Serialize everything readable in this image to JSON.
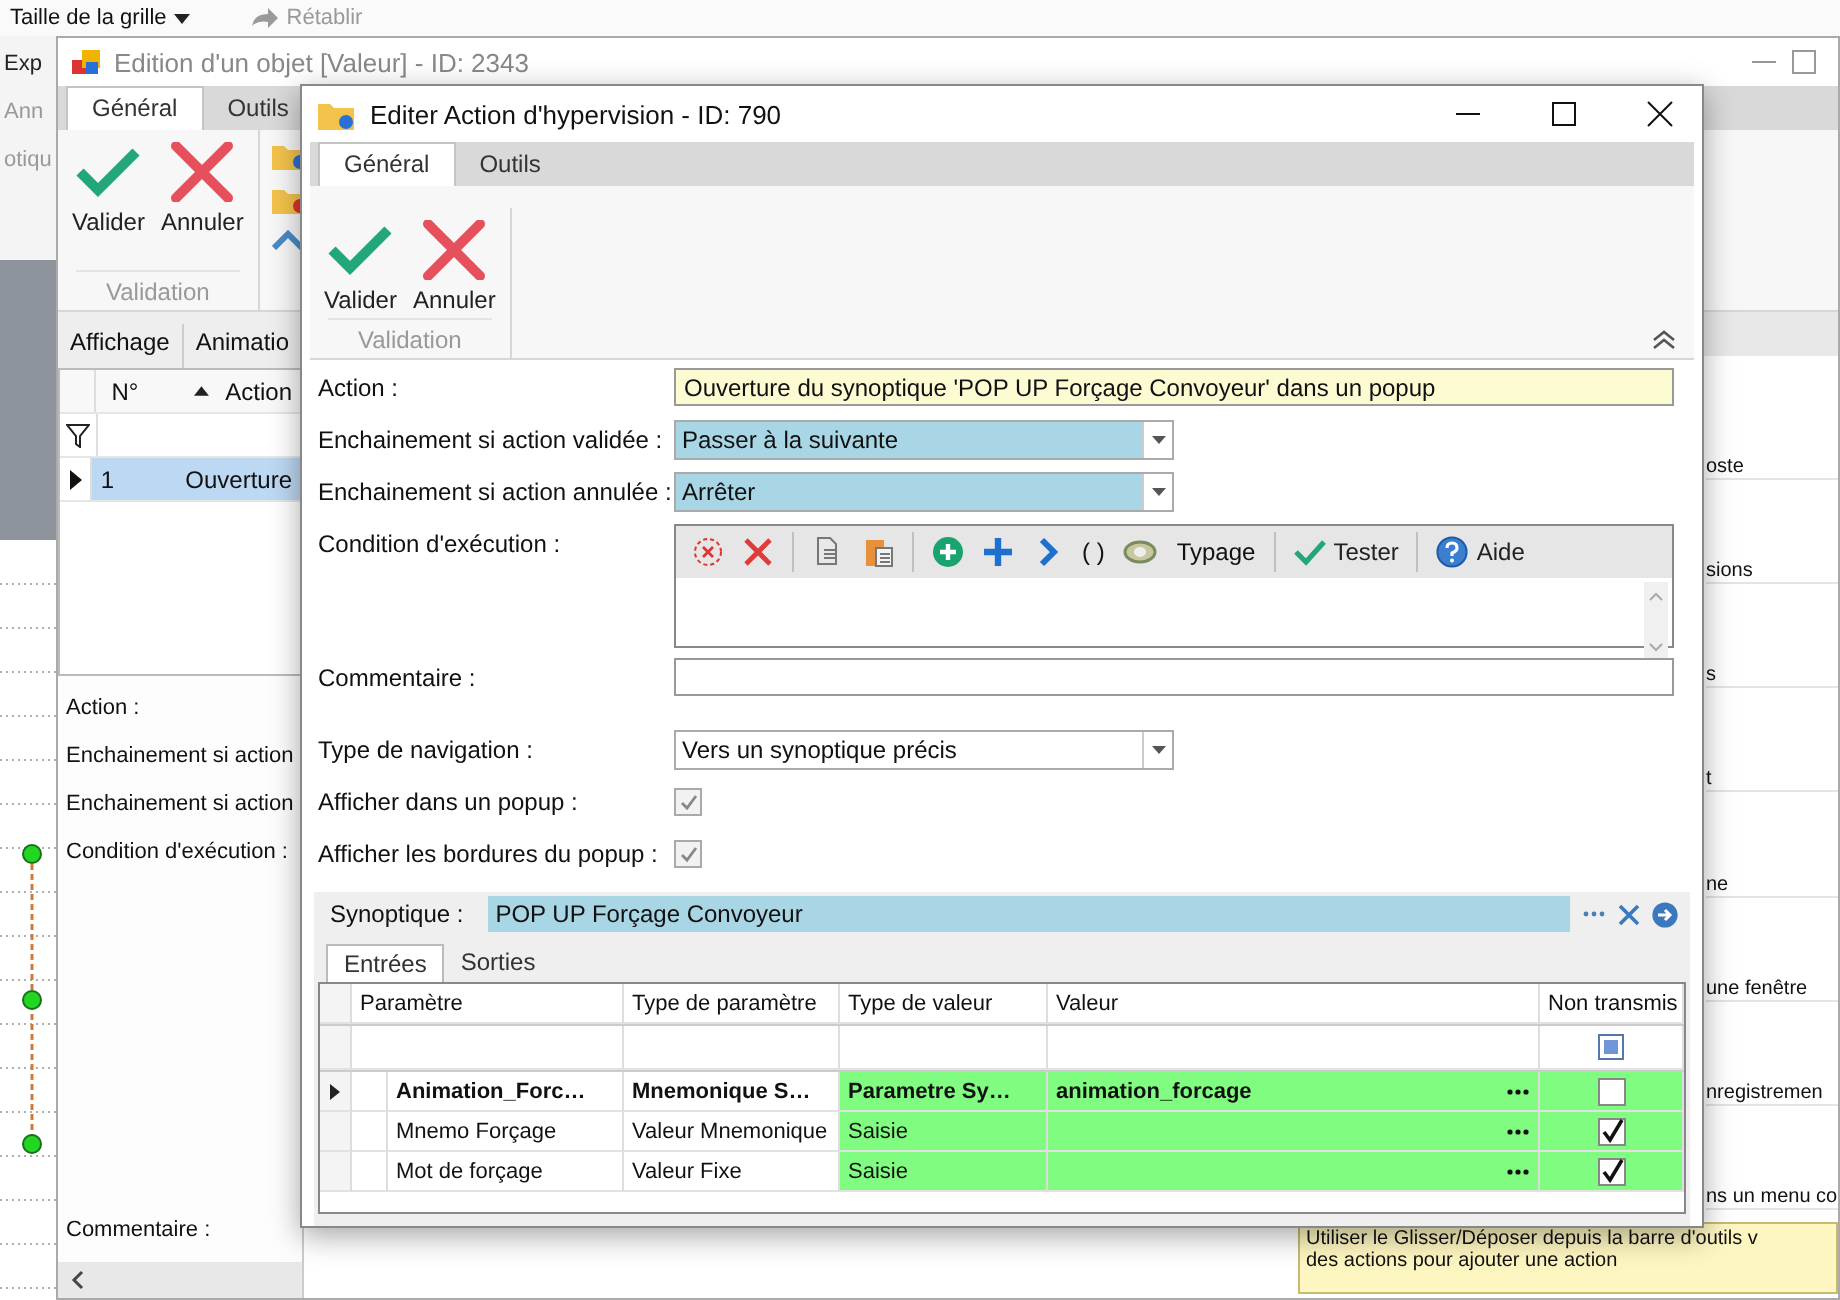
{
  "background_app": {
    "toolbar": [
      {
        "kind": "dropdown",
        "label": "Taille de la grille",
        "disabled": false
      },
      {
        "kind": "redo",
        "label": "Rétablir",
        "disabled": true
      }
    ],
    "partial_labels": [
      "Exp",
      "Ann",
      "otiqu"
    ]
  },
  "back_window": {
    "title": "Edition d'un objet [Valeur] - ID: 2343",
    "tabs": [
      {
        "label": "Général",
        "selected": true
      },
      {
        "label": "Outils",
        "selected": false
      }
    ],
    "ribbon_buttons": [
      {
        "kind": "validate",
        "label": "Valider"
      },
      {
        "kind": "cancel",
        "label": "Annuler"
      }
    ],
    "ribbon_group": "Validation",
    "grid_tabs": [
      "Affichage",
      "Animatio"
    ],
    "grid_columns": [
      "N°",
      "Action"
    ],
    "grid_rows": [
      {
        "number": "1",
        "action": "Ouverture",
        "selected": true
      }
    ],
    "form_labels": [
      "Action :",
      "Enchainement si action",
      "Enchainement si action",
      "Condition d'exécution :",
      "Commentaire :"
    ],
    "side_list": [
      "oste",
      "sions",
      "s",
      "t",
      "ne",
      "une fenêtre",
      "nregistremen",
      "ns un menu co"
    ],
    "hint": [
      "Utiliser le Glisser/Déposer depuis la barre d'outils v",
      "des actions pour ajouter une action"
    ]
  },
  "dialog": {
    "title": "Editer Action d'hypervision - ID: 790",
    "tabs": [
      {
        "label": "Général",
        "selected": true
      },
      {
        "label": "Outils",
        "selected": false
      }
    ],
    "ribbon_buttons": [
      {
        "kind": "validate",
        "label": "Valider"
      },
      {
        "kind": "cancel",
        "label": "Annuler"
      }
    ],
    "ribbon_group": "Validation",
    "fields": [
      {
        "kind": "text",
        "label": "Action :",
        "value": "Ouverture du synoptique 'POP UP Forçage Convoyeur' dans un popup",
        "readonly": true
      },
      {
        "kind": "combo",
        "label": "Enchainement si action validée :",
        "value": "Passer à la suivante",
        "highlighted": true
      },
      {
        "kind": "combo",
        "label": "Enchainement si action annulée :",
        "value": "Arrêter",
        "highlighted": true
      },
      {
        "kind": "condition",
        "label": "Condition d'exécution :"
      },
      {
        "kind": "text",
        "label": "Commentaire :",
        "readonly": false
      },
      {
        "kind": "combo",
        "label": "Type de navigation :",
        "value": "Vers un synoptique précis",
        "highlighted": false
      },
      {
        "kind": "checkbox",
        "label": "Afficher dans un popup :",
        "checked": true,
        "disabled": true
      },
      {
        "kind": "checkbox",
        "label": "Afficher les bordures du popup :",
        "checked": true,
        "disabled": true
      }
    ],
    "condition_toolbar": [
      {
        "kind": "clear"
      },
      {
        "kind": "delete"
      },
      {
        "kind": "separator"
      },
      {
        "kind": "copy"
      },
      {
        "kind": "paste"
      },
      {
        "kind": "separator"
      },
      {
        "kind": "add"
      },
      {
        "kind": "plus"
      },
      {
        "kind": "next"
      },
      {
        "kind": "text",
        "label": "( )"
      },
      {
        "kind": "convert"
      },
      {
        "kind": "text",
        "label": "Typage"
      },
      {
        "kind": "separator"
      },
      {
        "kind": "test",
        "label": "Tester"
      },
      {
        "kind": "separator"
      },
      {
        "kind": "help",
        "label": "Aide"
      }
    ],
    "synoptique": {
      "label": "Synoptique :",
      "value": "POP UP Forçage Convoyeur"
    },
    "sub_tabs": [
      {
        "label": "Entrées",
        "selected": true
      },
      {
        "label": "Sorties",
        "selected": false
      }
    ],
    "table": {
      "filter_row": {
        "indeterminate": true
      },
      "columns": [
        "Paramètre",
        "Type de paramètre",
        "Type de valeur",
        "Valeur",
        "Non transmis"
      ],
      "rows": [
        {
          "parameter": "Animation_Forc…",
          "parameter_type": "Mnemonique S…",
          "value_type": "Parametre Sy…",
          "value": "animation_forcage",
          "not_transmitted": false,
          "current": true,
          "children": [
            {
              "parameter": "Mnemo Forçage",
              "parameter_type": "Valeur Mnemonique",
              "value_type": "Saisie",
              "not_transmitted": true,
              "current": false
            },
            {
              "parameter": "Mot de forçage",
              "parameter_type": "Valeur Fixe",
              "value_type": "Saisie",
              "not_transmitted": true,
              "current": false
            }
          ]
        }
      ]
    }
  }
}
